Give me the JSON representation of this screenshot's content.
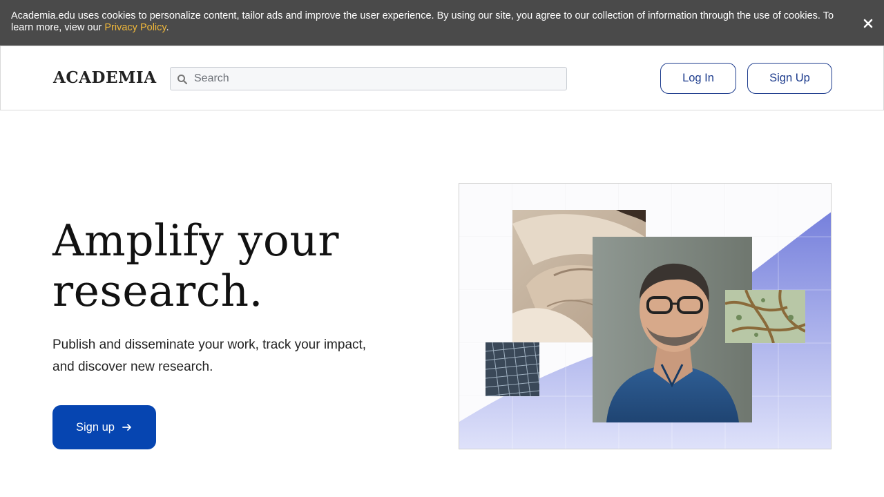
{
  "cookie_banner": {
    "text": "Academia.edu uses cookies to personalize content, tailor ads and improve the user experience. By using our site, you agree to our collection of information through the use of cookies. To learn more, view our ",
    "link_label": "Privacy Policy",
    "suffix": ".",
    "close_icon": "close-icon"
  },
  "header": {
    "logo": "ACADEMIA",
    "search": {
      "placeholder": "Search",
      "value": "",
      "icon": "search-icon"
    },
    "login_label": "Log In",
    "signup_label": "Sign Up"
  },
  "hero": {
    "title_line1": "Amplify your",
    "title_line2": "research.",
    "subtitle": "Publish and disseminate your work, track your impact, and discover new research.",
    "cta_label": "Sign up",
    "cta_icon": "arrow-right-icon"
  },
  "colors": {
    "banner_bg": "#4a4a4a",
    "link": "#f0b83a",
    "brand_blue": "#0645b1",
    "outline_blue": "#1b3a8c",
    "illustration_wave": "#7b86e0"
  }
}
